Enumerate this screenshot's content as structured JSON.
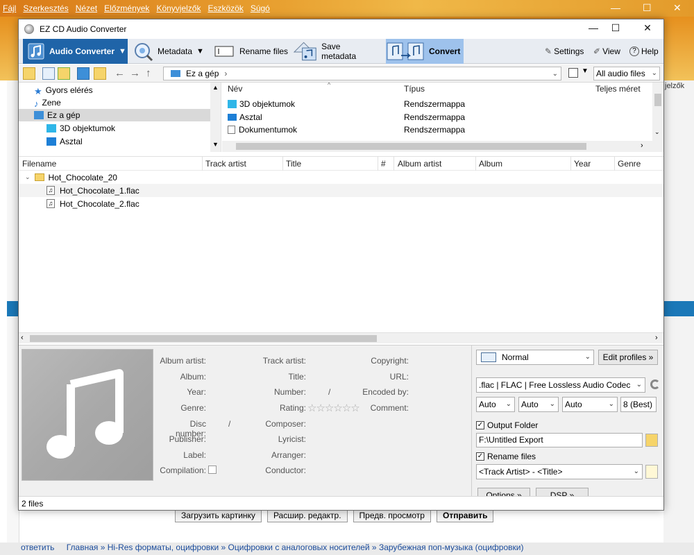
{
  "background": {
    "menu": [
      "Fájl",
      "Szerkesztés",
      "Nézet",
      "Előzmények",
      "Könyvjelzők",
      "Eszközök",
      "Súgó"
    ],
    "right_tag": "jelzők",
    "bottom_buttons": [
      "Загрузить картинку",
      "Расшир. редактр.",
      "Предв. просмотр",
      "Отправить"
    ],
    "footer": "Главная » Hi-Res форматы, оцифровки » Оцифровки с аналоговых носителей » Зарубежная поп-музыка (оцифровки)",
    "footer_btn": "ответить"
  },
  "window": {
    "title": "EZ CD Audio Converter",
    "controls": [
      "—",
      "☐",
      "✕"
    ]
  },
  "ribbon": {
    "audio_converter": "Audio Converter",
    "metadata": "Metadata",
    "rename_files": "Rename files",
    "save_metadata": "Save metadata",
    "convert": "Convert",
    "settings": "Settings",
    "view": "View",
    "help": "Help"
  },
  "navbar": {
    "address": "Ez a gép",
    "filter": "All audio files"
  },
  "tree": {
    "items": [
      "Gyors elérés",
      "Zene",
      "Ez a gép",
      "3D objektumok",
      "Asztal"
    ]
  },
  "browser": {
    "headers": [
      "Név",
      "Típus",
      "Teljes méret"
    ],
    "rows": [
      {
        "name": "3D objektumok",
        "type": "Rendszermappa"
      },
      {
        "name": "Asztal",
        "type": "Rendszermappa"
      },
      {
        "name": "Dokumentumok",
        "type": "Rendszermappa"
      }
    ]
  },
  "files": {
    "headers": [
      "Filename",
      "Track artist",
      "Title",
      "#",
      "Album artist",
      "Album",
      "Year",
      "Genre"
    ],
    "folder": "Hot_Chocolate_20",
    "items": [
      "Hot_Chocolate_1.flac",
      "Hot_Chocolate_2.flac"
    ]
  },
  "metadata": {
    "album_artist": "Album artist:",
    "album": "Album:",
    "year": "Year:",
    "genre": "Genre:",
    "disc_number": "Disc number:",
    "publisher": "Publisher:",
    "label": "Label:",
    "compilation": "Compilation:",
    "track_artist": "Track artist:",
    "title": "Title:",
    "number": "Number:",
    "rating": "Rating:",
    "composer": "Composer:",
    "lyricist": "Lyricist:",
    "arranger": "Arranger:",
    "conductor": "Conductor:",
    "copyright": "Copyright:",
    "url": "URL:",
    "encoded_by": "Encoded by:",
    "comment": "Comment:",
    "slash": "/",
    "stars": "☆☆☆☆☆☆"
  },
  "settings": {
    "profile": "Normal",
    "edit_profiles": "Edit profiles »",
    "codec": ".flac | FLAC | Free Lossless Audio Codec",
    "auto1": "Auto",
    "auto2": "Auto",
    "auto3": "Auto",
    "quality": "8  (Best)",
    "output_folder_label": "Output Folder",
    "output_folder": "F:\\Untitled Export",
    "rename_files_label": "Rename files",
    "rename_pattern": "<Track Artist> - <Title>",
    "options": "Options »",
    "dsp": "DSP »"
  },
  "status": {
    "text": "2 files"
  }
}
